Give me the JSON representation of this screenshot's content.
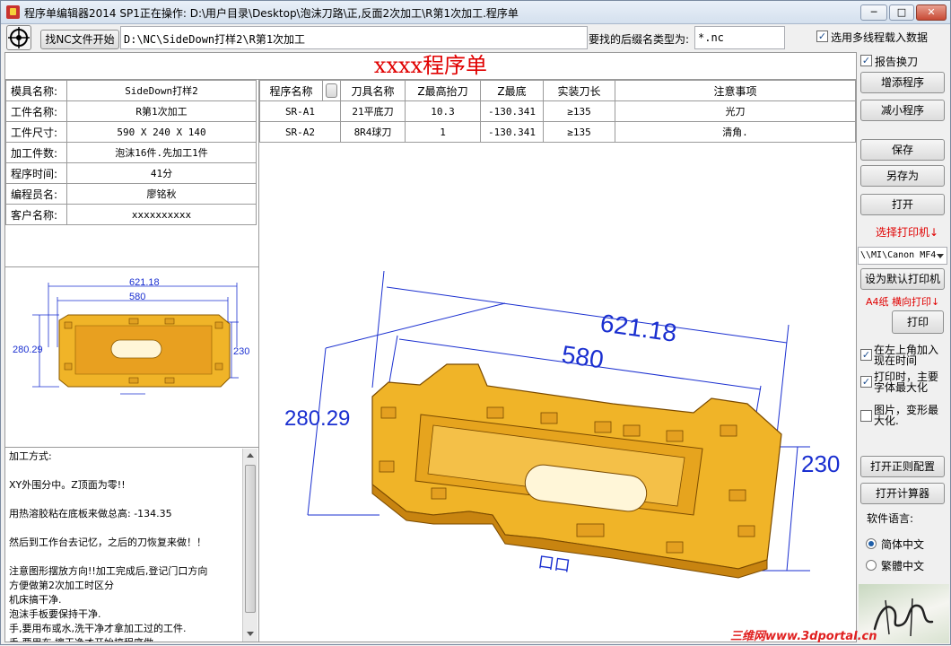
{
  "window": {
    "title": "程序单编辑器2014 SP1正在操作: D:\\用户目录\\Desktop\\泡沫刀路\\正,反面2次加工\\R第1次加工.程序单",
    "min_label": "─",
    "max_label": "□",
    "close_label": "✕"
  },
  "toolbar": {
    "find_button": "找NC文件开始",
    "path_value": "D:\\NC\\SideDown打样2\\R第1次加工",
    "ext_label": "要找的后缀名类型为:",
    "ext_value": "*.nc",
    "multiline_label": "选用多线程载入数据",
    "multiline_checked": true
  },
  "sheet": {
    "title": "xxxx程序单",
    "info": [
      {
        "key": "模具名称:",
        "value": "SideDown打样2"
      },
      {
        "key": "工件名称:",
        "value": "R第1次加工"
      },
      {
        "key": "工件尺寸:",
        "value": "590 X 240 X 140"
      },
      {
        "key": "加工件数:",
        "value": "泡沫16件.先加工1件"
      },
      {
        "key": "程序时间:",
        "value": "41分"
      },
      {
        "key": "编程员名:",
        "value": "廖铭秋"
      },
      {
        "key": "客户名称:",
        "value": "xxxxxxxxxx"
      }
    ],
    "columns": [
      "程序名称",
      "刀具名称",
      "Z最高抬刀",
      "Z最底",
      "实装刀长",
      "注意事项"
    ],
    "rows": [
      [
        "SR-A1",
        "21平底刀",
        "10.3",
        "-130.341",
        "≥135",
        "光刀"
      ],
      [
        "SR-A2",
        "8R4球刀",
        "1",
        "-130.341",
        "≥135",
        "清角."
      ]
    ],
    "dims": {
      "d1": "621.18",
      "d2": "580",
      "d3": "280.29",
      "d4": "230",
      "d5": "口口"
    },
    "notes": [
      "加工方式:",
      "",
      "XY外围分中。Z顶面为零!!",
      "",
      "用热溶胶粘在底板来做总高:  -134.35",
      "",
      "然后到工作台去记忆，之后的刀恢复来做！！",
      "",
      "注意图形摆放方向!!加工完成后,登记门口方向",
      "方便做第2次加工时区分",
      "机床搞干净.",
      "泡沫手板要保持干净.",
      "手,要用布或水,洗干净才拿加工过的工件.",
      "手,要用布,擦干净才开始搞程序做."
    ]
  },
  "sidebar": {
    "report_label": "报告换刀",
    "report_checked": true,
    "add_program": "增添程序",
    "remove_program": "减小程序",
    "save": "保存",
    "save_as": "另存为",
    "open": "打开",
    "choose_printer": "选择打印机↓",
    "printer_value": "\\\\MI\\Canon MF4",
    "set_default_printer": "设为默认打印机",
    "print_mode": "A4纸  横向打印↓",
    "print": "打印",
    "opt_time": "在左上角加入现在时间",
    "opt_time_checked": true,
    "opt_maxfont": "打印时，主要字体最大化",
    "opt_maxfont_checked": true,
    "opt_image": "图片，变形最大化.",
    "opt_image_checked": false,
    "open_regex": "打开正则配置",
    "open_calc": "打开计算器",
    "lang_label": "软件语言:",
    "lang_simplified": "简体中文",
    "lang_traditional": "繁體中文",
    "lang_selected": "简体中文"
  },
  "watermark": "三维网www.3dportal.cn",
  "colors": {
    "title_red": "#e00000",
    "part_yellow": "#f0b428",
    "dim_blue": "#1a2fd0"
  }
}
